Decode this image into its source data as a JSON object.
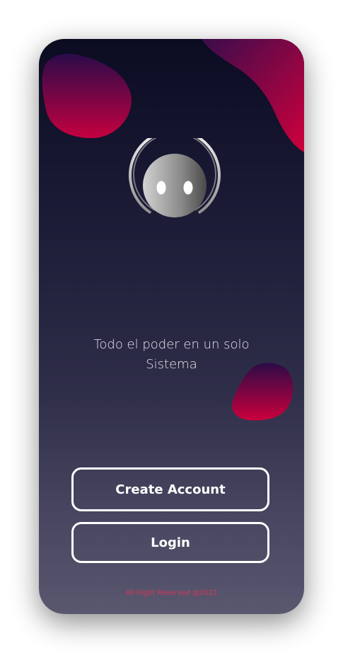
{
  "welcome": {
    "tagline_line1": "Todo el poder en un solo",
    "tagline_line2": "Sistema",
    "create_account_label": "Create Account",
    "login_label": "Login",
    "footer": "All Right Reserved @2021"
  },
  "colors": {
    "background_top": "#0b0b22",
    "background_bottom": "#5a586f",
    "blob_gradient_start": "#2a0b4a",
    "blob_gradient_end": "#c5003f",
    "footer_text": "#d6355a",
    "button_border": "#ffffff"
  },
  "icons": {
    "logo": "robot-face-logo-icon"
  }
}
